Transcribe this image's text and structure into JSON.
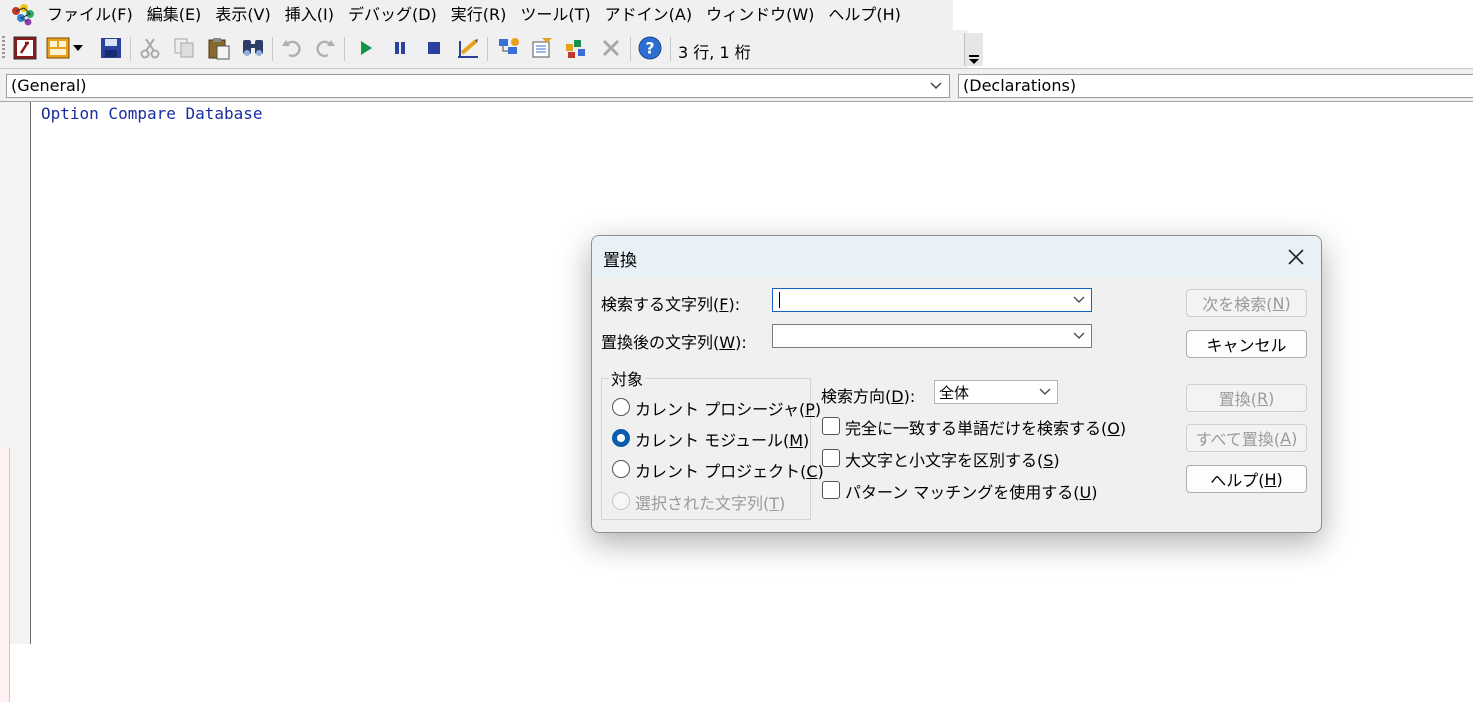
{
  "menu": {
    "items": [
      "ファイル(F)",
      "編集(E)",
      "表示(V)",
      "挿入(I)",
      "デバッグ(D)",
      "実行(R)",
      "ツール(T)",
      "アドイン(A)",
      "ウィンドウ(W)",
      "ヘルプ(H)"
    ]
  },
  "toolbar": {
    "status": "3 行, 1 桁",
    "buttons": [
      "view-access-icon",
      "insert-module-icon",
      "save-icon",
      "cut-icon",
      "copy-icon",
      "paste-icon",
      "find-icon",
      "undo-icon",
      "redo-icon",
      "run-icon",
      "break-icon",
      "reset-icon",
      "design-mode-icon",
      "project-explorer-icon",
      "properties-icon",
      "object-browser-icon",
      "toolbox-icon",
      "help-icon"
    ]
  },
  "object_bar": {
    "object": "(General)",
    "procedure": "(Declarations)"
  },
  "code": {
    "line1": "Option Compare Database"
  },
  "dialog": {
    "title": "置換",
    "find_label_pre": "検索する文字列(",
    "find_label_key": "F",
    "find_label_post": "):",
    "find_value": "",
    "replace_label_pre": "置換後の文字列(",
    "replace_label_key": "W",
    "replace_label_post": "):",
    "replace_value": "",
    "scope": {
      "title": "対象",
      "options": [
        {
          "pre": "カレント プロシージャ(",
          "key": "P",
          "post": ")",
          "checked": false,
          "enabled": true
        },
        {
          "pre": "カレント モジュール(",
          "key": "M",
          "post": ")",
          "checked": true,
          "enabled": true
        },
        {
          "pre": "カレント プロジェクト(",
          "key": "C",
          "post": ")",
          "checked": false,
          "enabled": true
        },
        {
          "pre": "選択された文字列(",
          "key": "T",
          "post": ")",
          "checked": false,
          "enabled": false
        }
      ]
    },
    "direction": {
      "label_pre": "検索方向(",
      "label_key": "D",
      "label_post": "):",
      "value": "全体"
    },
    "options": [
      {
        "pre": "完全に一致する単語だけを検索する(",
        "key": "O",
        "post": ")",
        "checked": false
      },
      {
        "pre": "大文字と小文字を区別する(",
        "key": "S",
        "post": ")",
        "checked": false
      },
      {
        "pre": "パターン マッチングを使用する(",
        "key": "U",
        "post": ")",
        "checked": false
      }
    ],
    "buttons": {
      "find_next": {
        "pre": "次を検索(",
        "key": "N",
        "post": ")"
      },
      "cancel": "キャンセル",
      "replace": {
        "pre": "置換(",
        "key": "R",
        "post": ")"
      },
      "replace_all": {
        "pre": "すべて置換(",
        "key": "A",
        "post": ")"
      },
      "help": {
        "pre": "ヘルプ(",
        "key": "H",
        "post": ")"
      }
    }
  },
  "colors": {
    "code_text": "#1a2d9e",
    "dialog_title_bg": "#e8f1f6",
    "accent": "#0b5cab"
  }
}
